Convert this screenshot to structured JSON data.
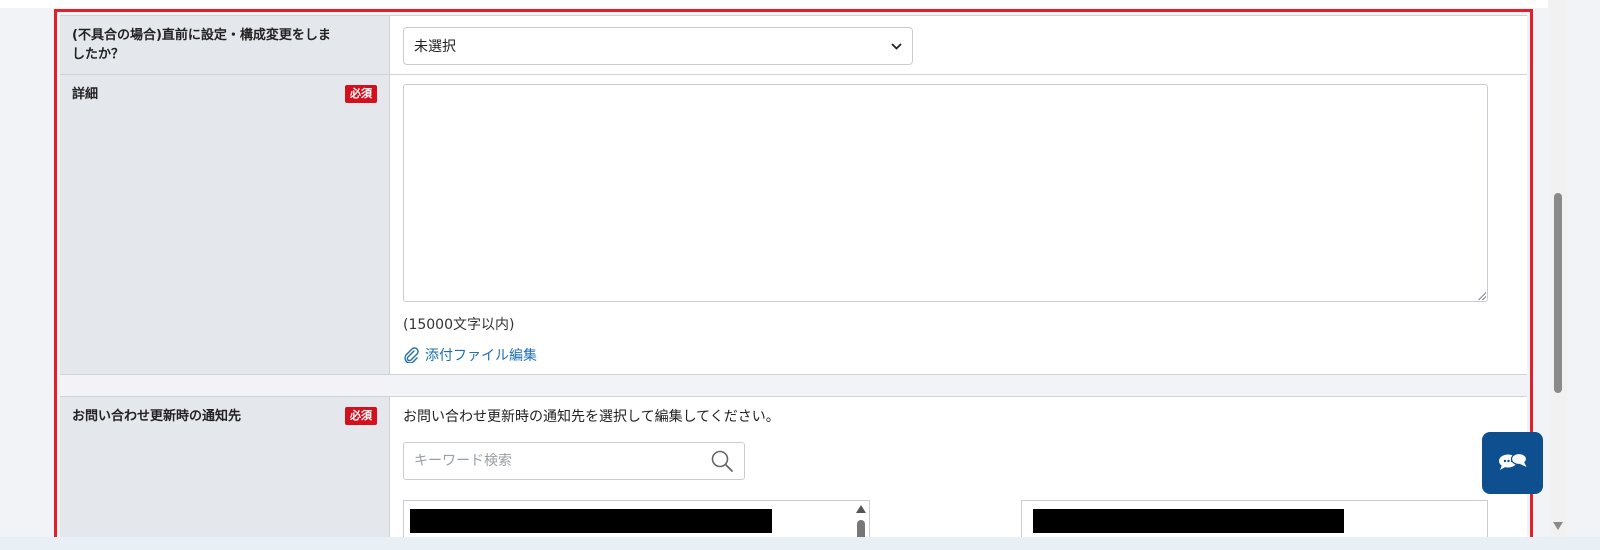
{
  "form": {
    "change_question": {
      "label": "(不具合の場合)直前に設定・構成変更をしましたか？",
      "select_value": "未選択"
    },
    "details": {
      "label": "詳細",
      "required_badge": "必須",
      "char_limit": "(15000文字以内)",
      "attach_link": "添付ファイル編集"
    },
    "notification": {
      "label": "お問い合わせ更新時の通知先",
      "required_badge": "必須",
      "instruction": "お問い合わせ更新時の通知先を選択して編集してください。",
      "search_placeholder": "キーワード検索"
    }
  },
  "colors": {
    "highlight_border": "#e0202a",
    "required_badge": "#d2101e",
    "link": "#1f6fb5",
    "chat_widget": "#0e4f8f"
  },
  "icons": [
    "chevron-down-icon",
    "paperclip-icon",
    "search-icon",
    "chat-icon"
  ]
}
